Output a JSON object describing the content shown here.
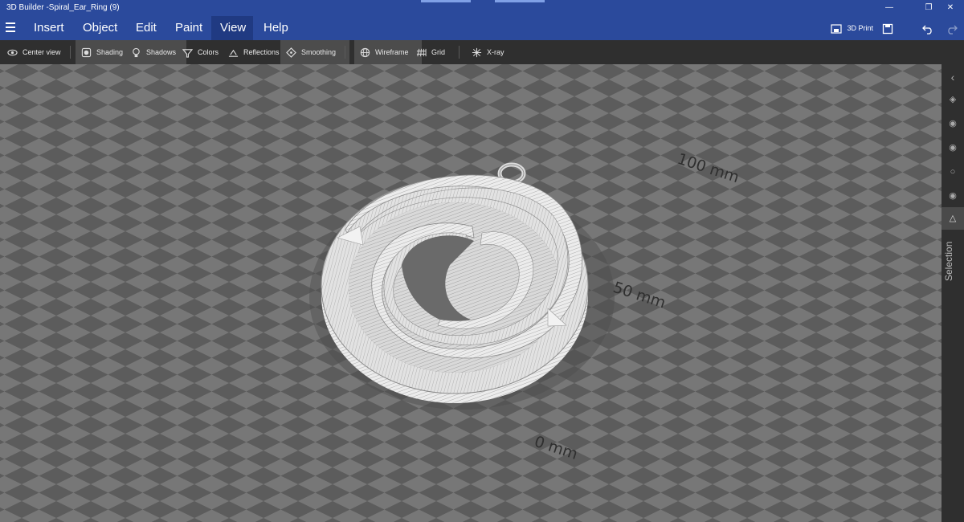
{
  "window": {
    "title": "3D Builder -Spiral_Ear_Ring (9)"
  },
  "menu": {
    "items": [
      {
        "label": "Insert"
      },
      {
        "label": "Object"
      },
      {
        "label": "Edit"
      },
      {
        "label": "Paint"
      },
      {
        "label": "View"
      },
      {
        "label": "Help"
      }
    ],
    "active": "View",
    "print_label": "3D Print"
  },
  "toolbar": {
    "items": [
      {
        "label": "Center view",
        "icon": "eye-icon"
      },
      {
        "label": "Shading",
        "icon": "shading-icon"
      },
      {
        "label": "Shadows",
        "icon": "lightbulb-icon"
      },
      {
        "label": "Colors",
        "icon": "colors-icon"
      },
      {
        "label": "Reflections",
        "icon": "reflections-icon"
      },
      {
        "label": "Smoothing",
        "icon": "smoothing-icon"
      },
      {
        "label": "Wireframe",
        "icon": "globe-icon"
      },
      {
        "label": "Grid",
        "icon": "grid-icon"
      },
      {
        "label": "X-ray",
        "icon": "xray-icon"
      }
    ],
    "active": [
      "Shading",
      "Shadows",
      "Smoothing",
      "Wireframe"
    ]
  },
  "viewport": {
    "ruler_labels": [
      "100 mm",
      "50 mm",
      "0 mm"
    ],
    "model": "spiral-earring"
  },
  "rightpanel": {
    "label": "Selection"
  },
  "colors": {
    "titlebar": "#2b4a9c",
    "toolbar": "#2f2f2f",
    "grid_dark": "#5c5c5c",
    "grid_light": "#777777",
    "model": "#e6e6e6"
  }
}
